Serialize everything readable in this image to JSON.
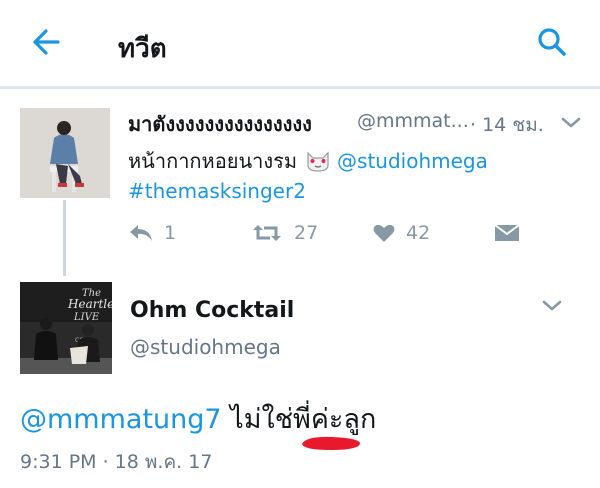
{
  "header": {
    "back_icon": "arrow-left-icon",
    "title": "ทวีต",
    "search_icon": "search-icon",
    "accent_color": "#1b95e0"
  },
  "parent_tweet": {
    "display_name": "มาตังงงงงงงงงงงงงงง",
    "handle": "@mmmat...",
    "time": "· 14 ชม.",
    "text_part1": "หน้ากากหอยนางรม",
    "emoji": "heart-eyes-cat-emoji",
    "mention": "@studiohmega",
    "hashtag": "#themasksinger2",
    "reply_count": "1",
    "retweet_count": "27",
    "like_count": "42"
  },
  "main_tweet": {
    "display_name": "Ohm Cocktail",
    "handle": "@studiohmega",
    "mention": "@mmmatung7",
    "text": " ไม่ใช่พี่ค่ะลูก",
    "timestamp": "9:31 PM · 18 พ.ค. 17",
    "avatar_text_1": "The",
    "avatar_text_2": "Heartless",
    "avatar_text_3": "LIVE",
    "avatar_text_4": "COCK"
  },
  "colors": {
    "text": "#14171a",
    "secondary": "#657786",
    "icon_gray": "#8899a6",
    "red_mark": "#e8192c"
  }
}
